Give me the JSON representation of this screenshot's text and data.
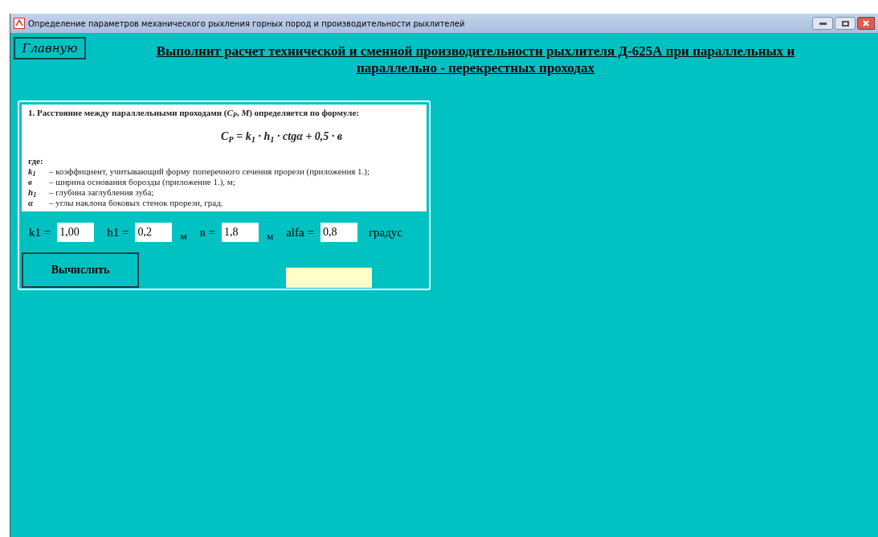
{
  "window": {
    "title": "Определение параметров механического рыхления горных пород и производительности рыхлителей"
  },
  "home_button": "Главную",
  "heading": "Выполнит расчет технической и сменной производительности рыхлителя Д-625А при параллельных и параллельно - перекрестных проходах",
  "formula_card": {
    "title": "1. Расстояние между параллельными проходами (*C$_{P}$*, *M*) определяется по формуле:",
    "formula": "C$_{P}$ = k$_{1}$ · h$_{1}$ · ctgα + 0,5 · в",
    "where": "где:",
    "definitions": [
      {
        "symbol": "k$_{1}$",
        "text": "–  коэффициент, учитывающий форму поперечного сечения прорези (приложения 1.);"
      },
      {
        "symbol": "в",
        "text": "–  ширина основания борозды (приложение 1.), м;"
      },
      {
        "symbol": "h$_{1}$",
        "text": "–  глубина заглубления зуба;"
      },
      {
        "symbol": "α",
        "text": "–  углы наклона боковых стенок прорези, град."
      }
    ]
  },
  "inputs": [
    {
      "label": "k1 =",
      "value": "1,00"
    },
    {
      "label": "h1 =",
      "value": "0,2",
      "unit": "м"
    },
    {
      "label": "в =",
      "value": "1,8",
      "unit": "м"
    },
    {
      "label": "alfa =",
      "value": "0,8",
      "unit": "градус"
    }
  ],
  "calculate_button": "Вычислить"
}
